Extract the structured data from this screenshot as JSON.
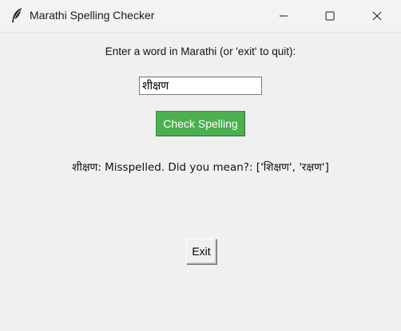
{
  "window": {
    "title": "Marathi Spelling Checker",
    "icons": {
      "app": "feather-icon",
      "minimize": "minimize-icon",
      "maximize": "maximize-icon",
      "close": "close-icon"
    }
  },
  "form": {
    "prompt": "Enter a word in Marathi (or 'exit' to quit):",
    "input_value": "शीक्षण",
    "check_button_label": "Check Spelling",
    "result": "शीक्षण: Misspelled. Did you mean?: ['शिक्षण', 'रक्षण']",
    "exit_button_label": "Exit"
  },
  "colors": {
    "check_button_bg": "#4caf50",
    "check_button_text": "#ffffff",
    "window_bg": "#f0f0f0"
  }
}
